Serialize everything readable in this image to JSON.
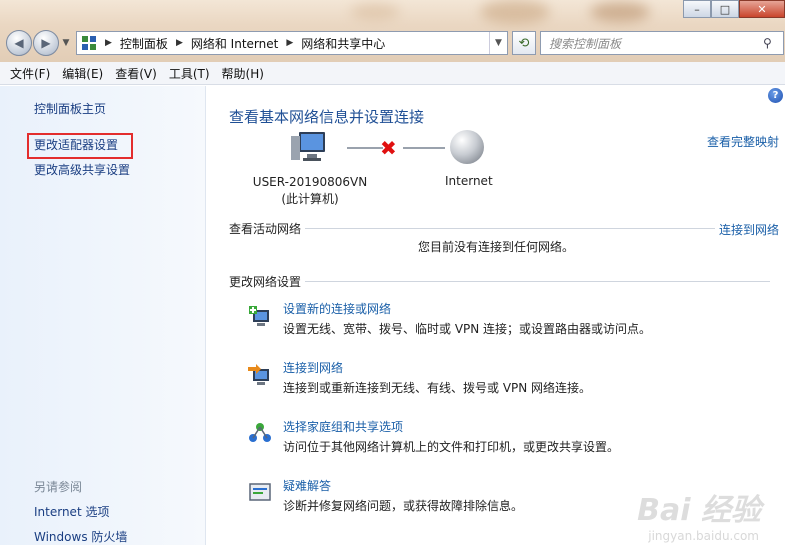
{
  "window": {
    "minimize_glyph": "–",
    "maximize_glyph": "□",
    "close_glyph": "✕"
  },
  "address": {
    "segments": [
      "控制面板",
      "网络和 Internet",
      "网络和共享中心"
    ]
  },
  "search": {
    "placeholder": "搜索控制面板"
  },
  "menu": [
    "文件(F)",
    "编辑(E)",
    "查看(V)",
    "工具(T)",
    "帮助(H)"
  ],
  "sidebar": {
    "items": [
      "控制面板主页",
      "更改适配器设置",
      "更改高级共享设置"
    ],
    "see_also_header": "另请参阅",
    "see_also": [
      "Internet 选项",
      "Windows 防火墙"
    ]
  },
  "main": {
    "title": "查看基本网络信息并设置连接",
    "full_map": "查看完整映射",
    "computer_name": "USER-20190806VN",
    "computer_sub": "(此计算机)",
    "internet_label": "Internet",
    "active_networks_header": "查看活动网络",
    "connect_to_network": "连接到网络",
    "no_network_msg": "您目前没有连接到任何网络。",
    "change_settings_header": "更改网络设置",
    "tasks": [
      {
        "link": "设置新的连接或网络",
        "desc": "设置无线、宽带、拨号、临时或 VPN 连接；或设置路由器或访问点。"
      },
      {
        "link": "连接到网络",
        "desc": "连接到或重新连接到无线、有线、拨号或 VPN 网络连接。"
      },
      {
        "link": "选择家庭组和共享选项",
        "desc": "访问位于其他网络计算机上的文件和打印机，或更改共享设置。"
      },
      {
        "link": "疑难解答",
        "desc": "诊断并修复网络问题，或获得故障排除信息。"
      }
    ]
  },
  "watermark": {
    "main": "Bai 经验",
    "sub": "jingyan.baidu.com"
  }
}
